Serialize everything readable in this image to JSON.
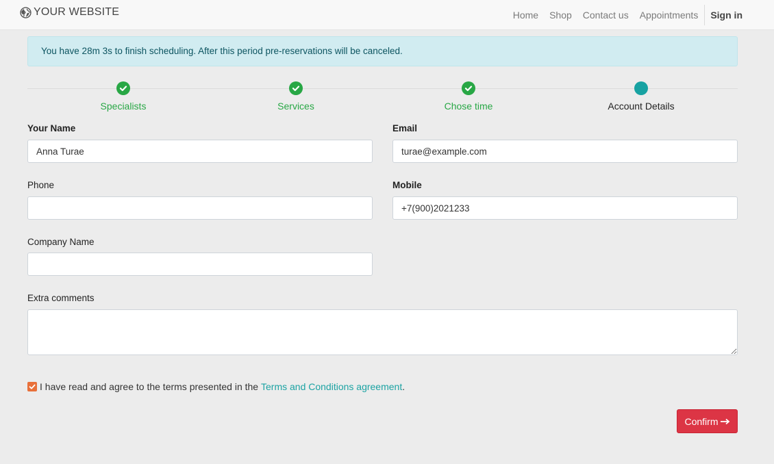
{
  "navbar": {
    "brand": "YOUR WEBSITE",
    "brand_icon": "globe-icon",
    "links": [
      {
        "label": "Home"
      },
      {
        "label": "Shop"
      },
      {
        "label": "Contact us"
      },
      {
        "label": "Appointments"
      }
    ],
    "signin": "Sign in"
  },
  "alert": {
    "text": "You have 28m 3s to finish scheduling. After this period pre-reservations will be canceled."
  },
  "steps": [
    {
      "label": "Specialists",
      "state": "done"
    },
    {
      "label": "Services",
      "state": "done"
    },
    {
      "label": "Chose time",
      "state": "done"
    },
    {
      "label": "Account Details",
      "state": "current"
    }
  ],
  "form": {
    "name": {
      "label": "Your Name",
      "value": "Anna Turae"
    },
    "email": {
      "label": "Email",
      "value": "turae@example.com"
    },
    "phone": {
      "label": "Phone",
      "value": ""
    },
    "mobile": {
      "label": "Mobile",
      "value": "+7(900)2021233"
    },
    "company": {
      "label": "Company Name",
      "value": ""
    },
    "comments": {
      "label": "Extra comments",
      "value": ""
    },
    "agree": {
      "checked": true,
      "text": "I have read and agree to the terms presented in the",
      "link": "Terms and Conditions agreement",
      "suffix": "."
    },
    "confirm_label": "Confirm",
    "confirm_icon": "arrow-right-icon"
  },
  "colors": {
    "done": "#28a745",
    "current": "#17a2a2",
    "confirm": "#dc3545",
    "checkbox": "#e8703a",
    "alert_bg": "#d1ecf1"
  }
}
